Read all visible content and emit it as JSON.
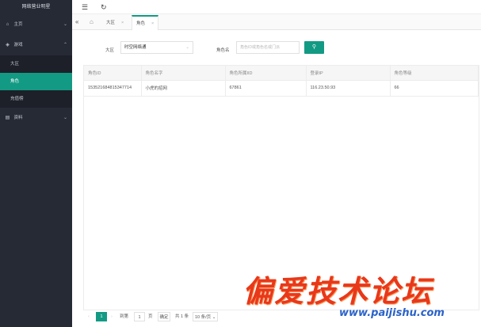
{
  "app": {
    "title": "网络营业明星"
  },
  "sidebar": {
    "items": [
      {
        "label": "主页",
        "icon": "home-icon",
        "glyph": "⌂",
        "chevron": "⌄"
      },
      {
        "label": "游戏",
        "icon": "diamond-icon",
        "glyph": "◈",
        "chevron": "⌃",
        "children": [
          {
            "label": "大区"
          },
          {
            "label": "角色",
            "active": true
          },
          {
            "label": "充值榜"
          }
        ]
      },
      {
        "label": "资料",
        "icon": "document-icon",
        "glyph": "▤",
        "chevron": "⌄"
      }
    ]
  },
  "topbar": {
    "menu_glyph": "☰",
    "refresh_glyph": "↻"
  },
  "tabs": {
    "back_glyph": "«",
    "home_glyph": "⌂",
    "items": [
      {
        "label": "大区",
        "close": "×"
      },
      {
        "label": "角色",
        "close": "×",
        "active": true
      }
    ]
  },
  "filters": {
    "region_label": "大区",
    "region_value": "时空网络通",
    "region_caret": "⌄",
    "role_label": "角色名",
    "role_placeholder": "角色ID或角色名或门派",
    "search_glyph": "⚲"
  },
  "table": {
    "columns": [
      "角色ID",
      "角色名字",
      "角色所属IID",
      "登录IP",
      "角色等级"
    ],
    "rows": [
      [
        "1535216848153477​14",
        "小虎的招网",
        "67861",
        "116.23.50.93",
        "66"
      ]
    ]
  },
  "pager": {
    "prev": "‹",
    "current": "1",
    "next": "›",
    "goto_label": "到第",
    "goto_value": "1",
    "page_unit": "页",
    "confirm": "确定",
    "total": "共 1 条",
    "per_page": "10 条/页",
    "per_page_caret": "⌄"
  },
  "watermark": {
    "text_cn": "偏爱技术论坛",
    "url": "www.paijishu.com"
  },
  "colors": {
    "accent": "#139a84",
    "sidebar_bg": "#262a35",
    "watermark_red": "#e8381a",
    "watermark_blue": "#2a62c9"
  }
}
